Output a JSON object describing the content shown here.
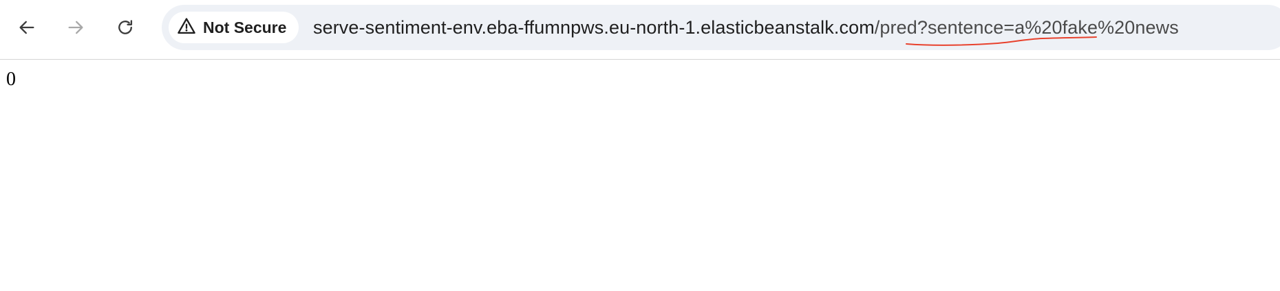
{
  "toolbar": {
    "back_icon": "arrow-left-icon",
    "forward_icon": "arrow-right-icon",
    "reload_icon": "reload-icon"
  },
  "omnibox": {
    "security_icon": "warning-triangle-icon",
    "security_label": "Not Secure",
    "url_host": "serve-sentiment-env.eba-ffumnpws.eu-north-1.elasticbeanstalk.com",
    "url_path": "/pred?sentence=a%20fake%20news",
    "annotation_color": "#e8412c"
  },
  "page": {
    "body_text": "0"
  },
  "colors": {
    "omnibox_bg": "#eef1f6",
    "icon_active": "#3c3c3c",
    "icon_disabled": "#a8a8a8"
  }
}
